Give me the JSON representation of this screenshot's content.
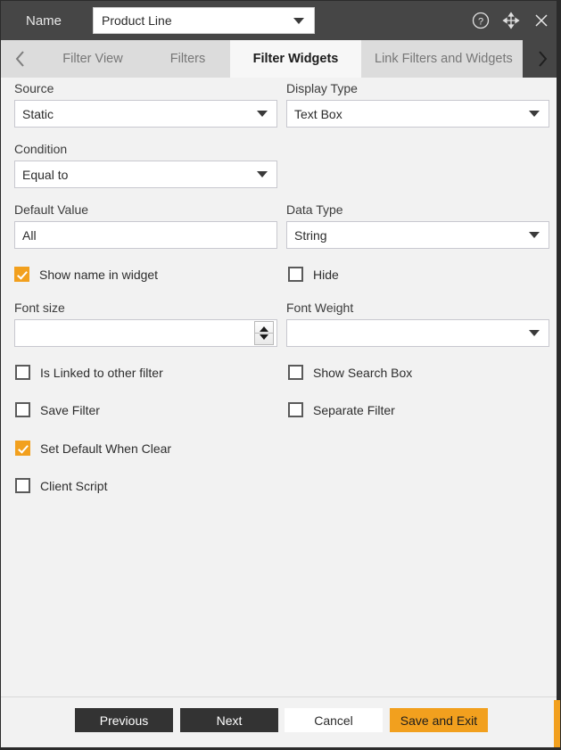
{
  "window": {
    "name_label": "Name",
    "name_value": "Product Line",
    "icons": {
      "help": "help-circle-icon",
      "move": "move-arrows-icon",
      "close": "close-x-icon"
    }
  },
  "tabs": {
    "prev_arrow": "chevron-left-icon",
    "next_arrow": "chevron-right-icon",
    "items": [
      {
        "label": "Filter View",
        "active": false
      },
      {
        "label": "Filters",
        "active": false
      },
      {
        "label": "Filter Widgets",
        "active": true
      },
      {
        "label": "Link Filters and Widgets",
        "active": false
      }
    ]
  },
  "form": {
    "source": {
      "label": "Source",
      "value": "Static"
    },
    "display_type": {
      "label": "Display Type",
      "value": "Text Box"
    },
    "condition": {
      "label": "Condition",
      "value": "Equal to"
    },
    "default_value": {
      "label": "Default Value",
      "value": "All"
    },
    "data_type": {
      "label": "Data Type",
      "value": "String"
    },
    "font_size": {
      "label": "Font size",
      "value": ""
    },
    "font_weight": {
      "label": "Font Weight",
      "value": ""
    }
  },
  "checkboxes": {
    "show_name_in_widget": {
      "label": "Show name in widget",
      "checked": true
    },
    "hide": {
      "label": "Hide",
      "checked": false
    },
    "is_linked": {
      "label": "Is Linked to other filter",
      "checked": false
    },
    "show_search_box": {
      "label": "Show Search Box",
      "checked": false
    },
    "save_filter": {
      "label": "Save Filter",
      "checked": false
    },
    "separate_filter": {
      "label": "Separate Filter",
      "checked": false
    },
    "set_default_when_clear": {
      "label": "Set Default When Clear",
      "checked": true
    },
    "client_script": {
      "label": "Client Script",
      "checked": false
    }
  },
  "footer": {
    "previous": "Previous",
    "next": "Next",
    "cancel": "Cancel",
    "save_and_exit": "Save and Exit"
  },
  "colors": {
    "accent": "#f2a01e",
    "titlebar": "#464646",
    "body": "#f2f2f2",
    "dark_button": "#333333"
  }
}
